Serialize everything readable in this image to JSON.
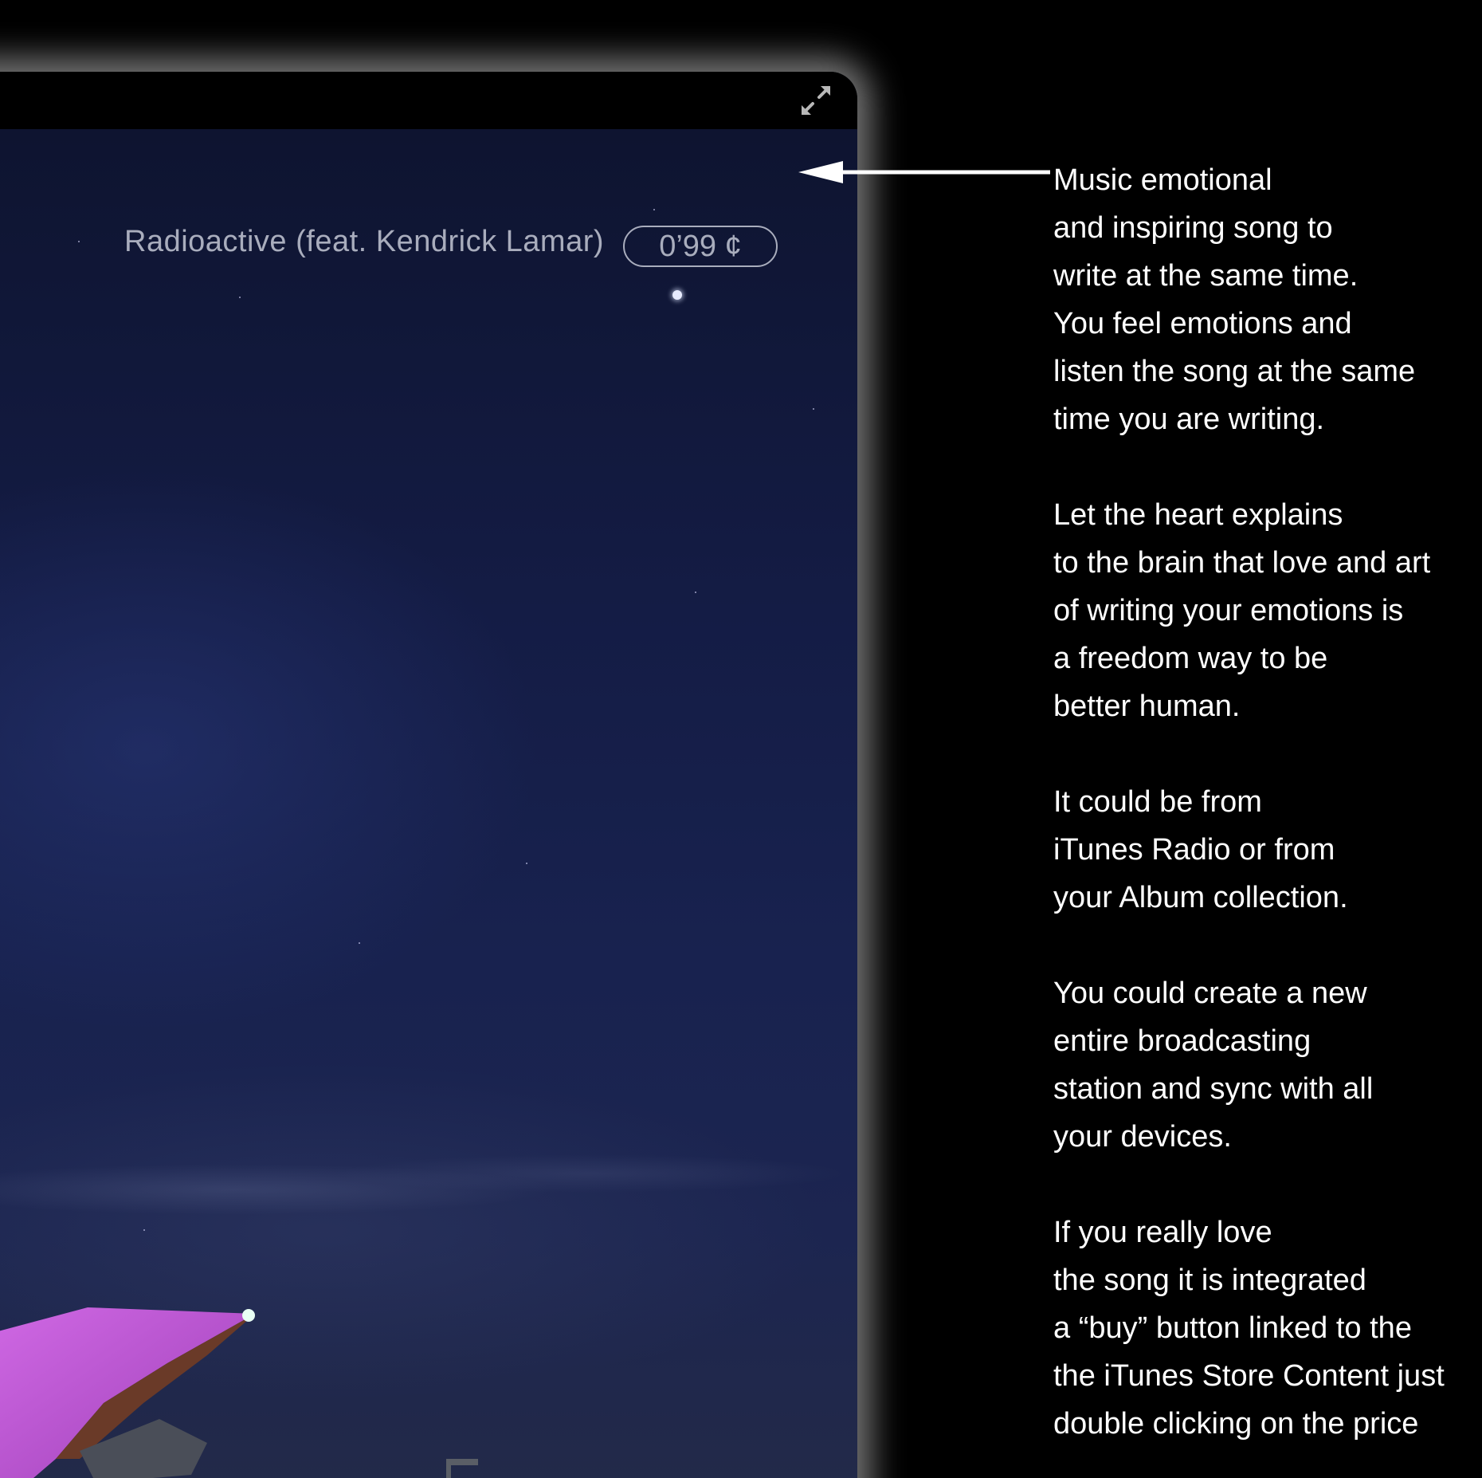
{
  "player": {
    "song_title": "Radioactive (feat. Kendrick Lamar)",
    "price_label": "0’99 ¢"
  },
  "icons": {
    "fullscreen": "fullscreen-expand-icon",
    "arrow": "left-arrow-icon"
  },
  "annotation": {
    "paragraphs": [
      "Music emotional\nand inspiring song to\nwrite at the same time.\nYou feel emotions and\nlisten the song at the same\ntime you are writing.",
      "Let the heart explains\nto the brain that love and art\nof writing your emotions is\na freedom way to be\nbetter human.",
      "It could be from\niTunes Radio or from\nyour Album collection.",
      "You could create a new\nentire broadcasting\nstation and sync with all\nyour devices.",
      "If you really love\nthe song it is integrated\na “buy” button linked to the\nthe iTunes Store Content just\ndouble clicking on the price"
    ]
  },
  "colors": {
    "background": "#000000",
    "sky": "#141c45",
    "text_muted": "#a9adbd",
    "annotation_text": "#ffffff",
    "opera_sail": "#c25ad8"
  }
}
